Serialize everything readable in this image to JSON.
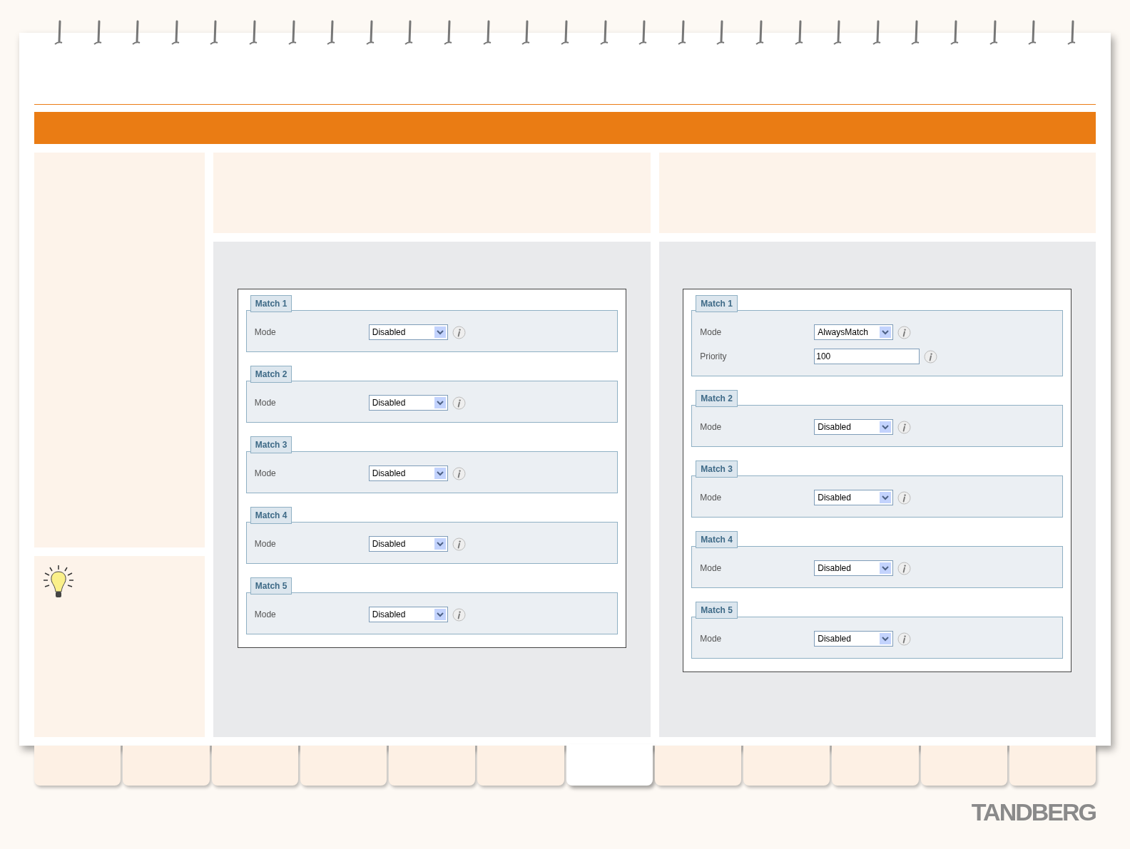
{
  "forms": [
    {
      "groups": [
        {
          "title": "Match 1",
          "fields": [
            {
              "kind": "select",
              "label": "Mode",
              "value": "Disabled"
            }
          ]
        },
        {
          "title": "Match 2",
          "fields": [
            {
              "kind": "select",
              "label": "Mode",
              "value": "Disabled"
            }
          ]
        },
        {
          "title": "Match 3",
          "fields": [
            {
              "kind": "select",
              "label": "Mode",
              "value": "Disabled"
            }
          ]
        },
        {
          "title": "Match 4",
          "fields": [
            {
              "kind": "select",
              "label": "Mode",
              "value": "Disabled"
            }
          ]
        },
        {
          "title": "Match 5",
          "fields": [
            {
              "kind": "select",
              "label": "Mode",
              "value": "Disabled"
            }
          ]
        }
      ]
    },
    {
      "groups": [
        {
          "title": "Match 1",
          "fields": [
            {
              "kind": "select",
              "label": "Mode",
              "value": "AlwaysMatch"
            },
            {
              "kind": "text",
              "label": "Priority",
              "value": "100"
            }
          ]
        },
        {
          "title": "Match 2",
          "fields": [
            {
              "kind": "select",
              "label": "Mode",
              "value": "Disabled"
            }
          ]
        },
        {
          "title": "Match 3",
          "fields": [
            {
              "kind": "select",
              "label": "Mode",
              "value": "Disabled"
            }
          ]
        },
        {
          "title": "Match 4",
          "fields": [
            {
              "kind": "select",
              "label": "Mode",
              "value": "Disabled"
            }
          ]
        },
        {
          "title": "Match 5",
          "fields": [
            {
              "kind": "select",
              "label": "Mode",
              "value": "Disabled"
            }
          ]
        }
      ]
    }
  ],
  "tabs": [
    {
      "selected": false
    },
    {
      "selected": false
    },
    {
      "selected": false
    },
    {
      "selected": false
    },
    {
      "selected": false
    },
    {
      "selected": false
    },
    {
      "selected": true
    },
    {
      "selected": false
    },
    {
      "selected": false
    },
    {
      "selected": false
    },
    {
      "selected": false
    },
    {
      "selected": false
    }
  ],
  "logo": "TANDBERG"
}
